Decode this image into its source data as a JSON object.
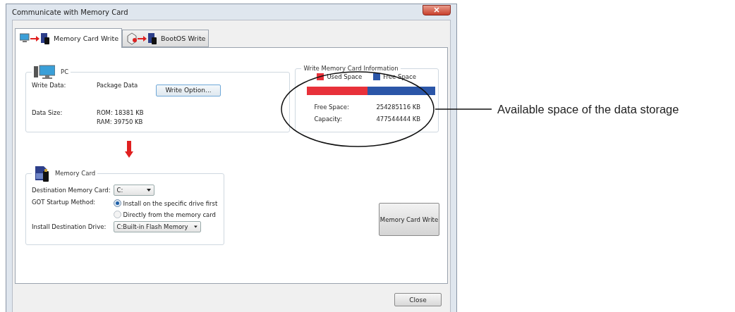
{
  "window": {
    "title": "Communicate with Memory Card"
  },
  "tabs": [
    {
      "label": "Memory Card Write",
      "selected": true
    },
    {
      "label": "BootOS Write",
      "selected": false
    }
  ],
  "pc": {
    "title": "PC",
    "rows": [
      {
        "label": "Write Data:",
        "values": [
          "Package Data"
        ],
        "button": "Write Option..."
      },
      {
        "label": "Data Size:",
        "values": [
          "ROM: 18381 KB",
          "RAM: 39750 KB"
        ]
      }
    ]
  },
  "info": {
    "title": "Write Memory Card Information",
    "legend": [
      {
        "label": "Used Space",
        "color": "#e8313a"
      },
      {
        "label": "Free Space",
        "color": "#2b56a8"
      }
    ],
    "used": {
      "level": 0.47
    },
    "rows": [
      {
        "label": "Free Space:",
        "value": "254285116 KB"
      },
      {
        "label": "Capacity:",
        "value": "477544444 KB"
      }
    ]
  },
  "memory_card": {
    "title": "Memory Card",
    "destination": {
      "label": "Destination Memory Card:",
      "value": "C:"
    },
    "startup": {
      "label": "GOT Startup Method:",
      "options": [
        {
          "label": "Install on the specific drive first",
          "selected": true
        },
        {
          "label": "Directly from the memory card",
          "selected": false
        }
      ]
    },
    "install_drive": {
      "label": "Install Destination Drive:",
      "value": "C:Built-in Flash Memory"
    }
  },
  "write_button": "Memory Card Write",
  "close_button": "Close",
  "annotation": "Available space of the data storage"
}
